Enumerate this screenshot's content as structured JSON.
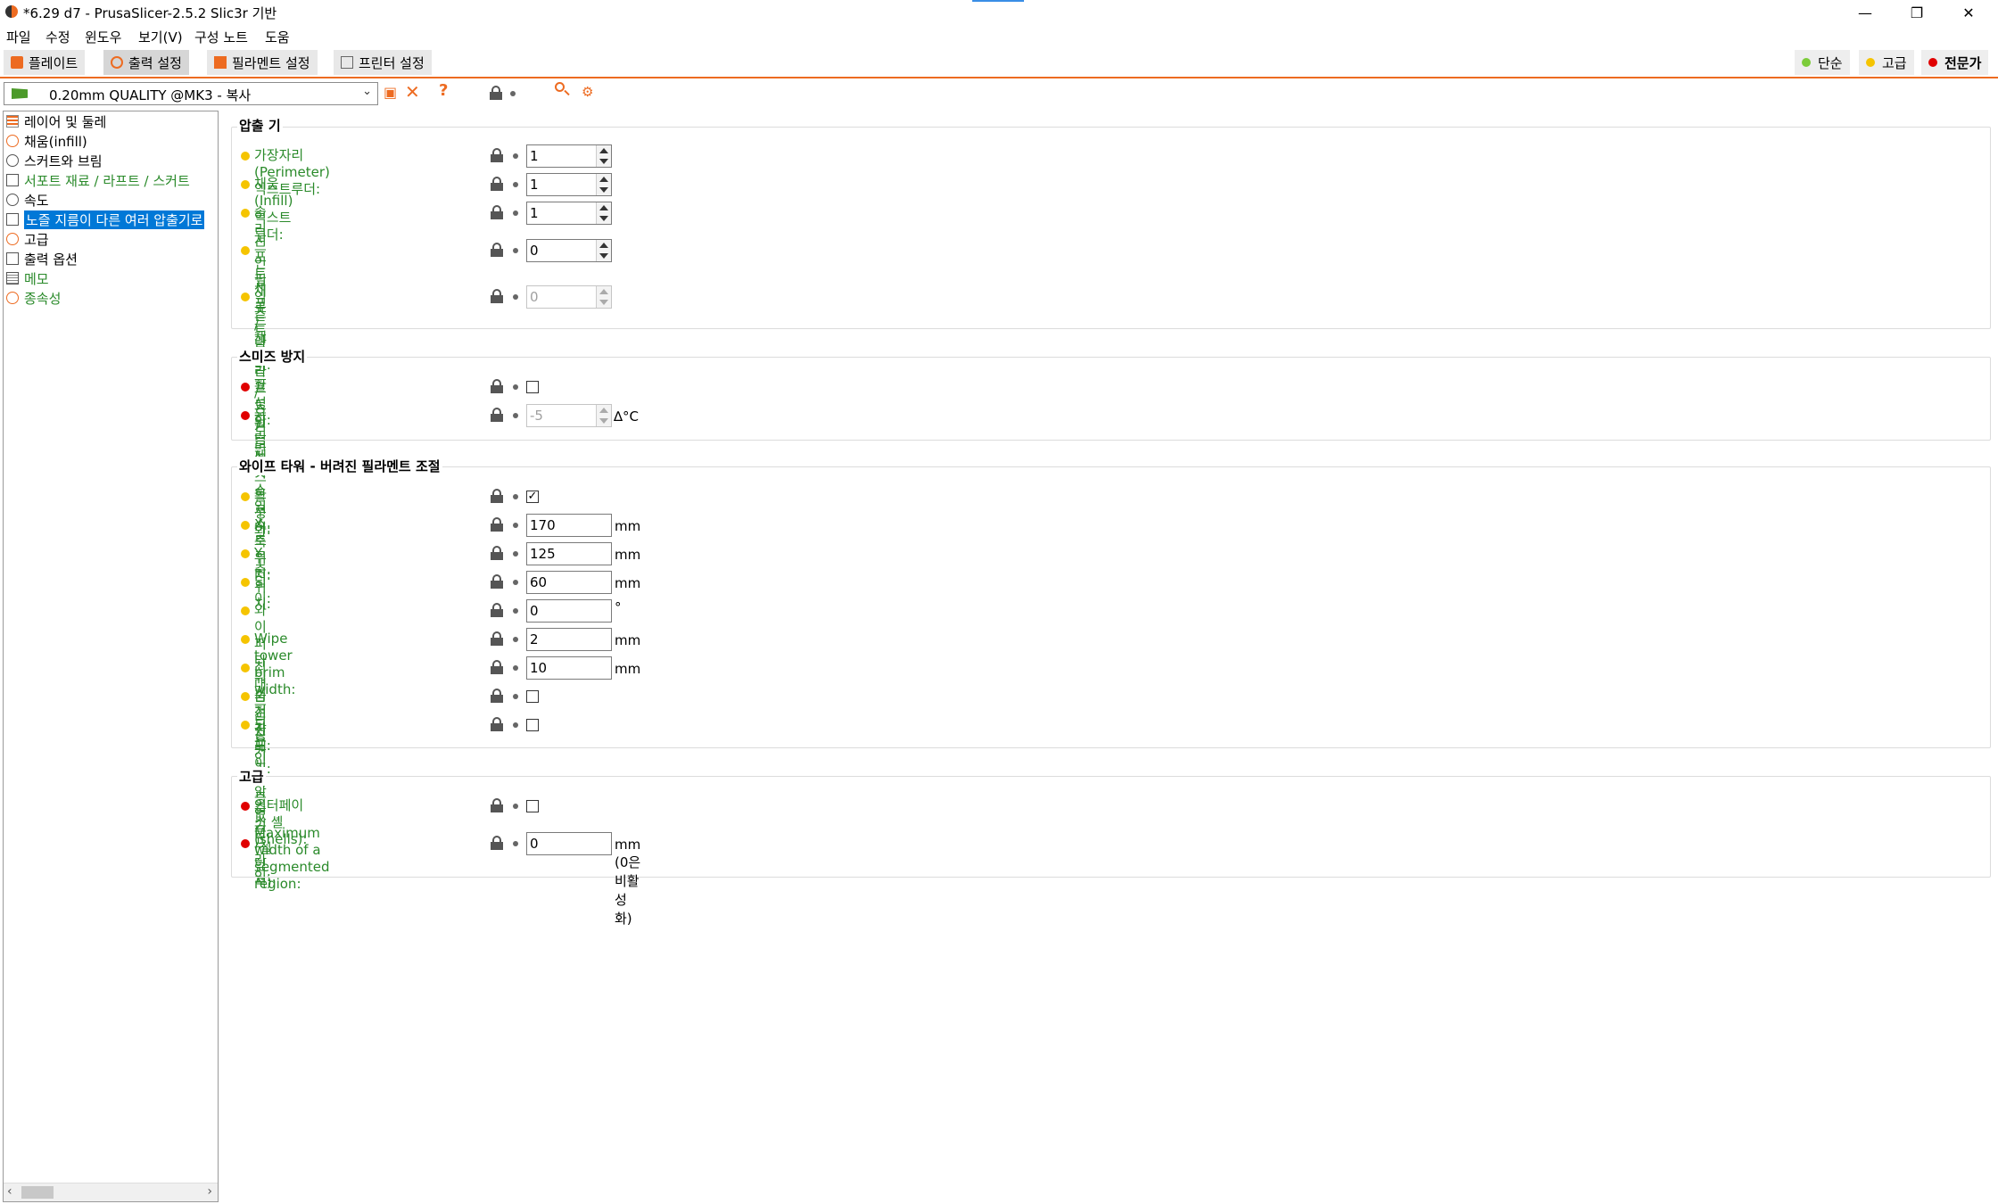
{
  "window": {
    "title": "*6.29 d7 - PrusaSlicer-2.5.2 Slic3r 기반",
    "minimize": "—",
    "restore": "❐",
    "close": "✕"
  },
  "menu": [
    "파일",
    "수정",
    "윈도우",
    "보기(V)",
    "구성 노트",
    "도움"
  ],
  "tabs": [
    {
      "label": "플레이트",
      "icon": "plater-icon"
    },
    {
      "label": "출력 설정",
      "icon": "cog-icon"
    },
    {
      "label": "필라멘트 설정",
      "icon": "spool-icon"
    },
    {
      "label": "프린터 설정",
      "icon": "printer-icon"
    }
  ],
  "modes": [
    {
      "label": "단순",
      "color": "#7ccc3a"
    },
    {
      "label": "고급",
      "color": "#f5c400"
    },
    {
      "label": "전문가",
      "color": "#e00000"
    }
  ],
  "preset": {
    "value": "0.20mm QUALITY @MK3 - 복사"
  },
  "toolbar_icons": {
    "save": "💾",
    "delete": "✕",
    "help": "?",
    "search": "🔍",
    "compare": "⚙"
  },
  "sidebar": [
    {
      "label": "레이어 및 둘레",
      "color": "#000000"
    },
    {
      "label": "채움(infill)",
      "color": "#000000"
    },
    {
      "label": "스커트와 브림",
      "color": "#000000"
    },
    {
      "label": "서포트 재료 / 라프트 / 스커트",
      "color": "#2a8a2a"
    },
    {
      "label": "속도",
      "color": "#000000"
    },
    {
      "label": "노즐 지름이 다른 여러 압출기로",
      "color": "#ffffff"
    },
    {
      "label": "고급",
      "color": "#000000"
    },
    {
      "label": "출력 옵션",
      "color": "#000000"
    },
    {
      "label": "메모",
      "color": "#2a8a2a"
    },
    {
      "label": "종속성",
      "color": "#2a8a2a"
    }
  ],
  "groups": {
    "extruders": {
      "title": "압출 기",
      "rows": [
        {
          "label": "가장자리(Perimeter) 익스트루더:",
          "value": "1"
        },
        {
          "label": "채움(Infill) 익스트루더:",
          "value": "1"
        },
        {
          "label": "솔리드 인필 익스트루더:",
          "value": "1"
        },
        {
          "label_line1": "서포트 재료 / 라프트 / 스커트",
          "label_line2": "익스트루더:",
          "value": "0"
        },
        {
          "label_line1": "서포트 재료/라프트 인터페이스",
          "label_line2": "익스트루더:",
          "value": "0"
        }
      ]
    },
    "ooze": {
      "title": "스미즈 방지",
      "enable_label": "활성화:",
      "temp_label": "온도 변화:",
      "temp_value": "-5",
      "temp_unit": "∆°C"
    },
    "wipe": {
      "title": "와이프 타워 - 버려진 필라멘트 조절",
      "enable_label": "활성화:",
      "enable_checked": "✓",
      "x_label": "X축 위치:",
      "x_value": "170",
      "x_unit": "mm",
      "y_label": "Y축 위치:",
      "y_value": "125",
      "y_unit": "mm",
      "width_label": "넓이:",
      "width_value": "60",
      "width_unit": "mm",
      "rot_label": "와이퍼 타워 회전각도:",
      "rot_value": "0",
      "rot_unit": "°",
      "brim_label": "Wipe tower brim width:",
      "brim_value": "2",
      "brim_unit": "mm",
      "bridge_label": "최대 브리징 거리:",
      "bridge_value": "10",
      "bridge_unit": "mm",
      "sparse_label": "숨겨진 레이어층 없음(실험적):",
      "prime_label": "모든 인쇄 압출기 프라임:"
    },
    "advanced": {
      "title": "고급",
      "shells_label": "인터페이스 셸(shells):",
      "seg_label_line1": "Maximum width of a segmented",
      "seg_label_line2": "region:",
      "seg_value": "0",
      "seg_unit": "mm (0은 비활성화)"
    }
  },
  "colors": {
    "simple": "#7ccc3a",
    "advanced": "#f5c400",
    "expert": "#e00000",
    "accent": "#ed6b21",
    "label_green": "#2a8a2a"
  }
}
